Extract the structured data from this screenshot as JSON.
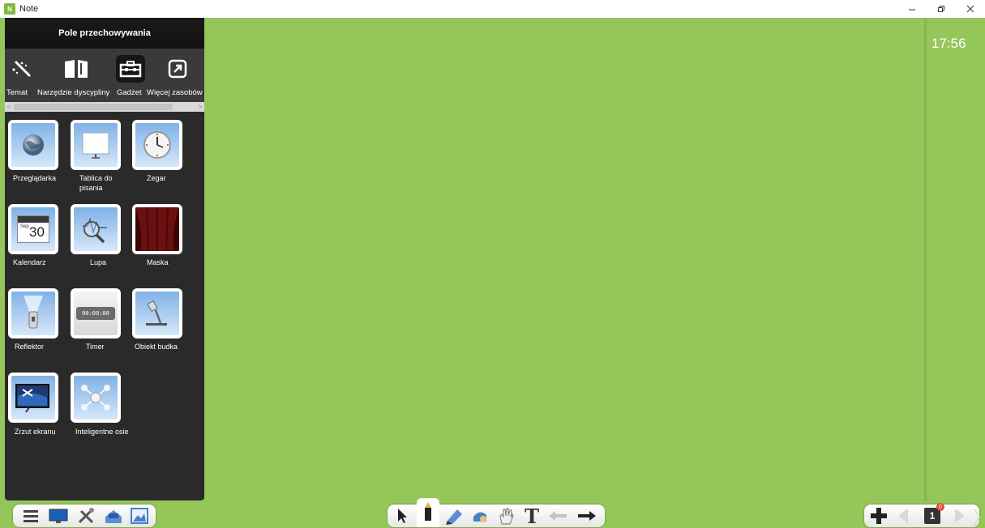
{
  "window": {
    "title": "Note",
    "app_icon_text": "N"
  },
  "clock": {
    "time": "17:56"
  },
  "panel": {
    "title": "Pole przechowywania",
    "categories": [
      {
        "label": "Temat",
        "icon": "magic-wand-icon"
      },
      {
        "label": "Narzędzie dyscypliny",
        "icon": "book-icon"
      },
      {
        "label": "Gadżet",
        "icon": "toolbox-icon",
        "selected": true
      },
      {
        "label": "Więcej zasobów",
        "icon": "external-link-icon"
      }
    ],
    "scroll": {
      "left": "<",
      "right": ">"
    },
    "gadgets": [
      {
        "label": "Przeglądarka",
        "icon": "globe-icon"
      },
      {
        "label": "Tablica do pisania",
        "icon": "whiteboard-icon"
      },
      {
        "label": "Zegar",
        "icon": "clock-icon"
      },
      {
        "label": "Kalendarz",
        "icon": "calendar-icon",
        "day": "30",
        "month": "Sep"
      },
      {
        "label": "Lupa",
        "icon": "magnifier-icon"
      },
      {
        "label": "Maska",
        "icon": "curtain-icon"
      },
      {
        "label": "Reflektor",
        "icon": "flashlight-icon"
      },
      {
        "label": "Timer",
        "icon": "timer-icon",
        "display": "00:00:00"
      },
      {
        "label": "Obiekt budka",
        "icon": "document-camera-icon"
      },
      {
        "label": "Zrzut ekranu",
        "icon": "screenshot-icon"
      },
      {
        "label": "Inteligentne osie",
        "icon": "mind-map-icon"
      }
    ]
  },
  "toolbar": {
    "left": [
      "menu-icon",
      "display-icon",
      "tools-icon",
      "resources-icon",
      "image-icon"
    ],
    "center": [
      "select-icon",
      "pen-icon",
      "highlighter-icon",
      "eraser-icon",
      "hand-icon",
      "text-icon",
      "undo-icon",
      "redo-icon"
    ],
    "text_tool": "T",
    "right": [
      "add-page-icon",
      "prev-page-icon",
      "page-thumbnail-icon",
      "next-page-icon"
    ],
    "page_number": "1",
    "page_badge": "0"
  },
  "colors": {
    "canvas": "#95c65a",
    "panel": "#2a2a2a",
    "accent": "#7fb1e6"
  }
}
